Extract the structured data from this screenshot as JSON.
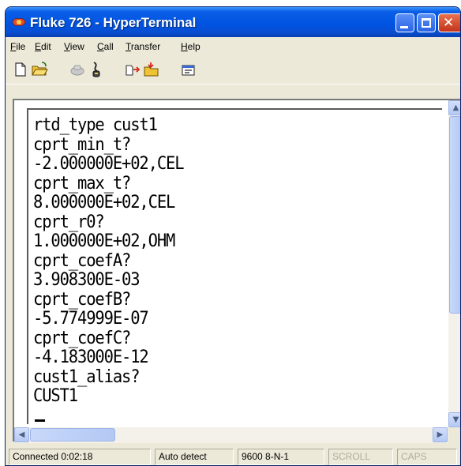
{
  "window": {
    "title": "Fluke 726 - HyperTerminal"
  },
  "menu": [
    "File",
    "Edit",
    "View",
    "Call",
    "Transfer",
    "Help"
  ],
  "toolbar": {
    "icons": [
      "new-connection-icon",
      "open-icon",
      "connect-icon",
      "disconnect-icon",
      "send-icon",
      "receive-icon",
      "properties-icon"
    ]
  },
  "terminal": {
    "lines": [
      "rtd_type cust1",
      "cprt_min_t?",
      "-2.000000E+02,CEL",
      "cprt_max_t?",
      "8.000000E+02,CEL",
      "cprt_r0?",
      "1.000000E+02,OHM",
      "cprt_coefA?",
      "3.908300E-03",
      "cprt_coefB?",
      "-5.774999E-07",
      "cprt_coefC?",
      "-4.183000E-12",
      "cust1_alias?",
      "CUST1"
    ]
  },
  "status": {
    "connected": "Connected 0:02:18",
    "detect": "Auto detect",
    "settings": "9600 8-N-1",
    "scroll": "SCROLL",
    "caps": "CAPS"
  },
  "colors": {
    "titlebar": "#0053e1",
    "frame": "#ece9d8",
    "close_button": "#c4341b"
  }
}
